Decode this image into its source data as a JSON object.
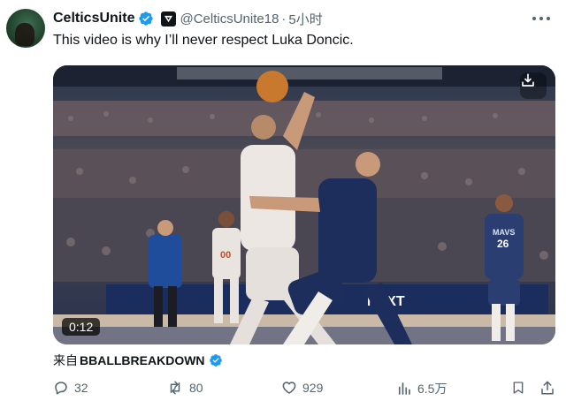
{
  "tweet": {
    "display_name": "CelticsUnite",
    "handle": "@CelticsUnite18",
    "separator": "·",
    "time": "5小时",
    "text": "This video is why I’ll never respect Luka Doncic."
  },
  "media": {
    "duration": "0:12",
    "scoreboard_text": "NEXT",
    "jersey_left": "00",
    "jersey_right": "26",
    "jersey_right_team": "MAVS"
  },
  "source": {
    "prefix": "来自",
    "account": "BBALLBREAKDOWN"
  },
  "actions": {
    "replies": "32",
    "retweets": "80",
    "likes": "929",
    "views": "6.5万"
  },
  "colors": {
    "verified_blue": "#1d9bf0",
    "muted_text": "#536471",
    "primary_text": "#0f1419"
  },
  "icons": [
    "verified-badge-icon",
    "affiliate-badge-icon",
    "more-icon",
    "download-icon",
    "reply-icon",
    "retweet-icon",
    "like-icon",
    "views-icon",
    "bookmark-icon",
    "share-icon"
  ]
}
